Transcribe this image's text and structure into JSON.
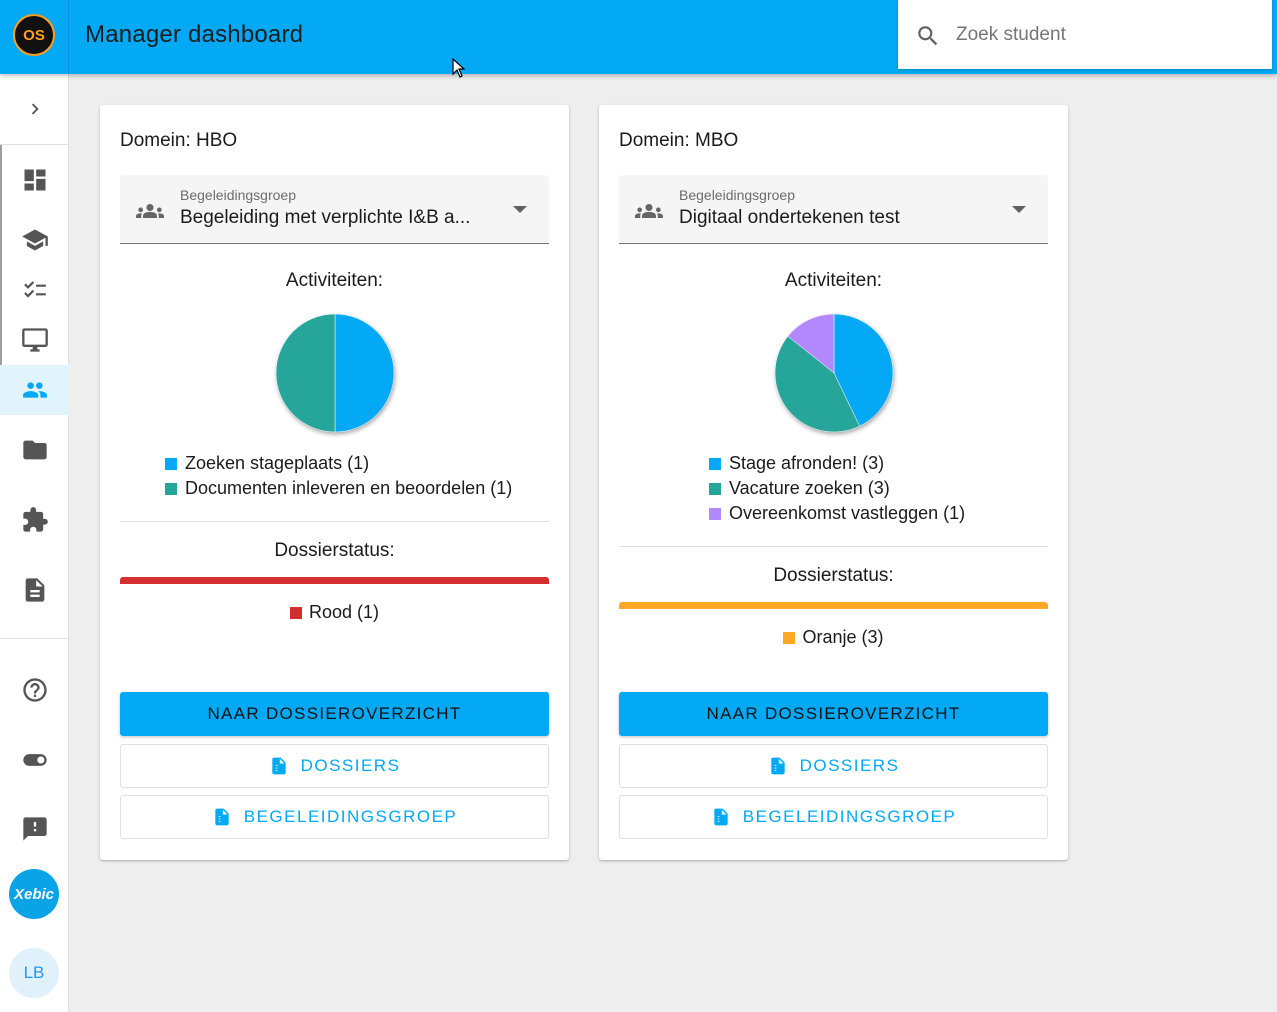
{
  "header": {
    "logo_text": "OS",
    "title": "Manager dashboard",
    "search_placeholder": "Zoek student",
    "bg_color": "#03a9f4"
  },
  "sidebar": {
    "items": [
      {
        "icon": "chevron-right-icon"
      },
      {
        "icon": "dashboard-icon"
      },
      {
        "icon": "school-icon"
      },
      {
        "icon": "checklist-icon"
      },
      {
        "icon": "monitor-icon"
      },
      {
        "icon": "group-icon",
        "active": true
      },
      {
        "icon": "folder-icon"
      },
      {
        "icon": "puzzle-icon"
      },
      {
        "icon": "document-icon"
      },
      {
        "icon": "help-icon"
      },
      {
        "icon": "toggle-icon"
      },
      {
        "icon": "feedback-icon"
      }
    ],
    "org_badge": "Xebic",
    "user_initials": "LB"
  },
  "cards": [
    {
      "domain": "Domein: HBO",
      "select_label": "Begeleidingsgroep",
      "select_value": "Begeleiding met verplichte I&B a...",
      "activities_title": "Activiteiten:",
      "activities": [
        {
          "label": "Zoeken stageplaats (1)",
          "value": 1,
          "color": "#03a9f4"
        },
        {
          "label": "Documenten inleveren en beoordelen (1)",
          "value": 1,
          "color": "#26a69a"
        }
      ],
      "status_title": "Dossierstatus:",
      "status": {
        "label": "Rood (1)",
        "color": "#d32f2f"
      },
      "primary_button": "NAAR DOSSIEROVERZICHT",
      "dossiers_button": "DOSSIERS",
      "group_button": "BEGELEIDINGSGROEP"
    },
    {
      "domain": "Domein: MBO",
      "select_label": "Begeleidingsgroep",
      "select_value": "Digitaal ondertekenen test",
      "activities_title": "Activiteiten:",
      "activities": [
        {
          "label": "Stage afronden! (3)",
          "value": 3,
          "color": "#03a9f4"
        },
        {
          "label": "Vacature zoeken (3)",
          "value": 3,
          "color": "#26a69a"
        },
        {
          "label": "Overeenkomst vastleggen (1)",
          "value": 1,
          "color": "#b388ff"
        }
      ],
      "status_title": "Dossierstatus:",
      "status": {
        "label": "Oranje (3)",
        "color": "#ffa726"
      },
      "primary_button": "NAAR DOSSIEROVERZICHT",
      "dossiers_button": "DOSSIERS",
      "group_button": "BEGELEIDINGSGROEP"
    }
  ]
}
